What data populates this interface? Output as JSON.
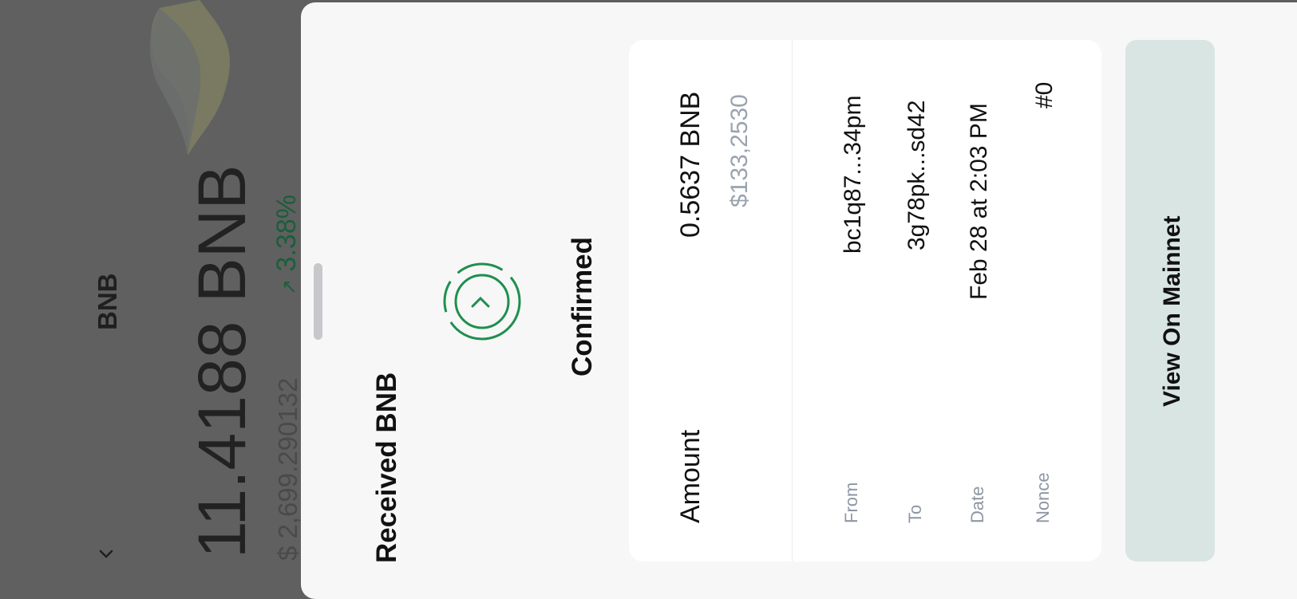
{
  "background": {
    "asset_name": "BNB",
    "balance": "11.4188 BNB",
    "fiat_value": "$ 2,699.290132",
    "change_percent": "3.38%",
    "change_arrow": "↗"
  },
  "sheet": {
    "title": "Received BNB",
    "status": "Confirmed",
    "status_icon": "check-circle-icon",
    "details": {
      "amount_label": "Amount",
      "amount_value": "0.5637 BNB",
      "amount_fiat": "$133,2530",
      "from_label": "From",
      "from_value": "bc1q87...34pm",
      "to_label": "To",
      "to_value": "3g78pk...sd42",
      "date_label": "Date",
      "date_value": "Feb 28 at 2:03 PM",
      "nonce_label": "Nonce",
      "nonce_value": "#0"
    },
    "action_label": "View On Mainnet"
  },
  "colors": {
    "accent_green": "#1f8f4e",
    "button_bg": "#d9e5e3",
    "muted_text": "#8e96a3"
  }
}
